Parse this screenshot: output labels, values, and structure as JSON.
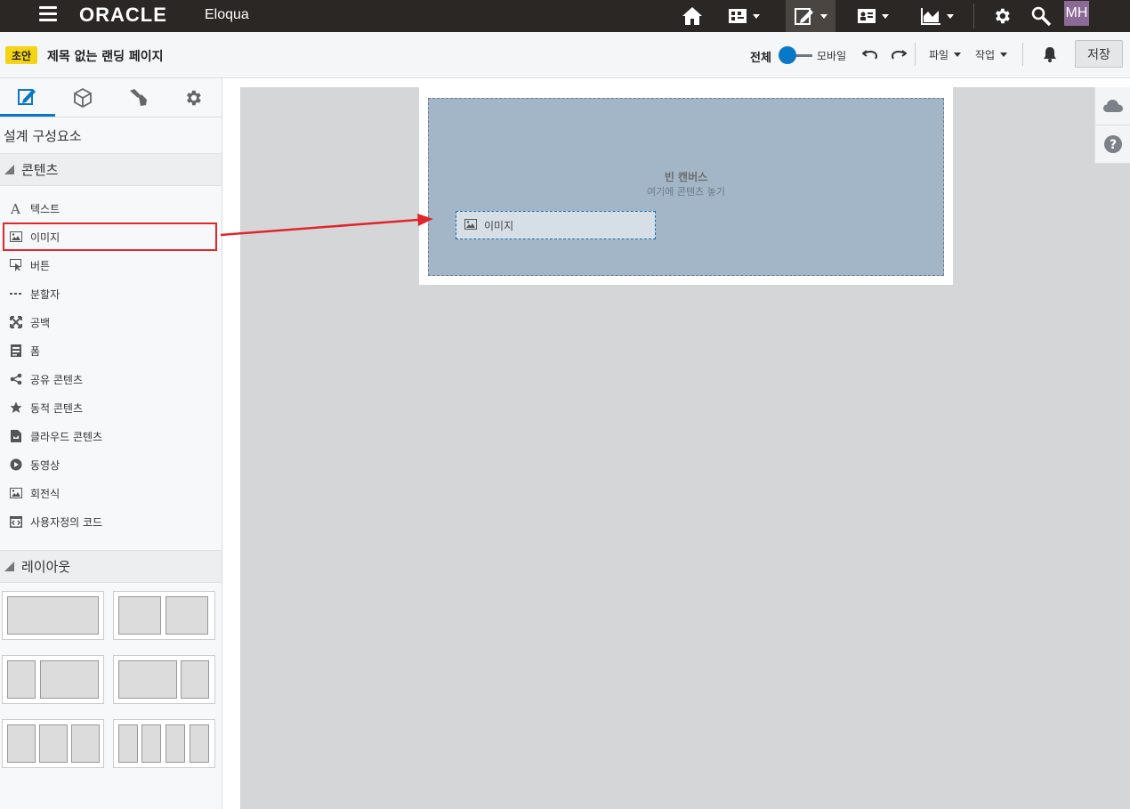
{
  "app": {
    "brand": "ORACLE",
    "product": "Eloqua",
    "user_initials": "MH"
  },
  "toolbar": {
    "draft_badge": "초안",
    "page_title": "제목 없는 랜딩 페이지",
    "view_full": "전체",
    "view_mobile": "모바일",
    "file_menu": "파일",
    "actions_menu": "작업",
    "save_label": "저장"
  },
  "sidebar": {
    "heading": "설계 구성요소",
    "content_section": "콘텐츠",
    "layout_section": "레이아웃",
    "items": [
      {
        "label": "텍스트",
        "icon": "text-icon"
      },
      {
        "label": "이미지",
        "icon": "image-icon"
      },
      {
        "label": "버튼",
        "icon": "button-icon"
      },
      {
        "label": "분할자",
        "icon": "divider-icon"
      },
      {
        "label": "공백",
        "icon": "spacer-icon"
      },
      {
        "label": "폼",
        "icon": "form-icon"
      },
      {
        "label": "공유 콘텐츠",
        "icon": "share-icon"
      },
      {
        "label": "동적 콘텐츠",
        "icon": "star-icon"
      },
      {
        "label": "클라우드 콘텐츠",
        "icon": "cloud-content-icon"
      },
      {
        "label": "동영상",
        "icon": "play-icon"
      },
      {
        "label": "회전식",
        "icon": "carousel-icon"
      },
      {
        "label": "사용자정의 코드",
        "icon": "code-icon"
      }
    ]
  },
  "canvas": {
    "empty_title": "빈 캔버스",
    "empty_subtitle": "여기에 콘텐츠 놓기",
    "dragged_item_label": "이미지"
  },
  "colors": {
    "topbar": "#2b2724",
    "accent": "#0a78c8",
    "highlight": "#e0262c",
    "draft": "#f5d415"
  }
}
